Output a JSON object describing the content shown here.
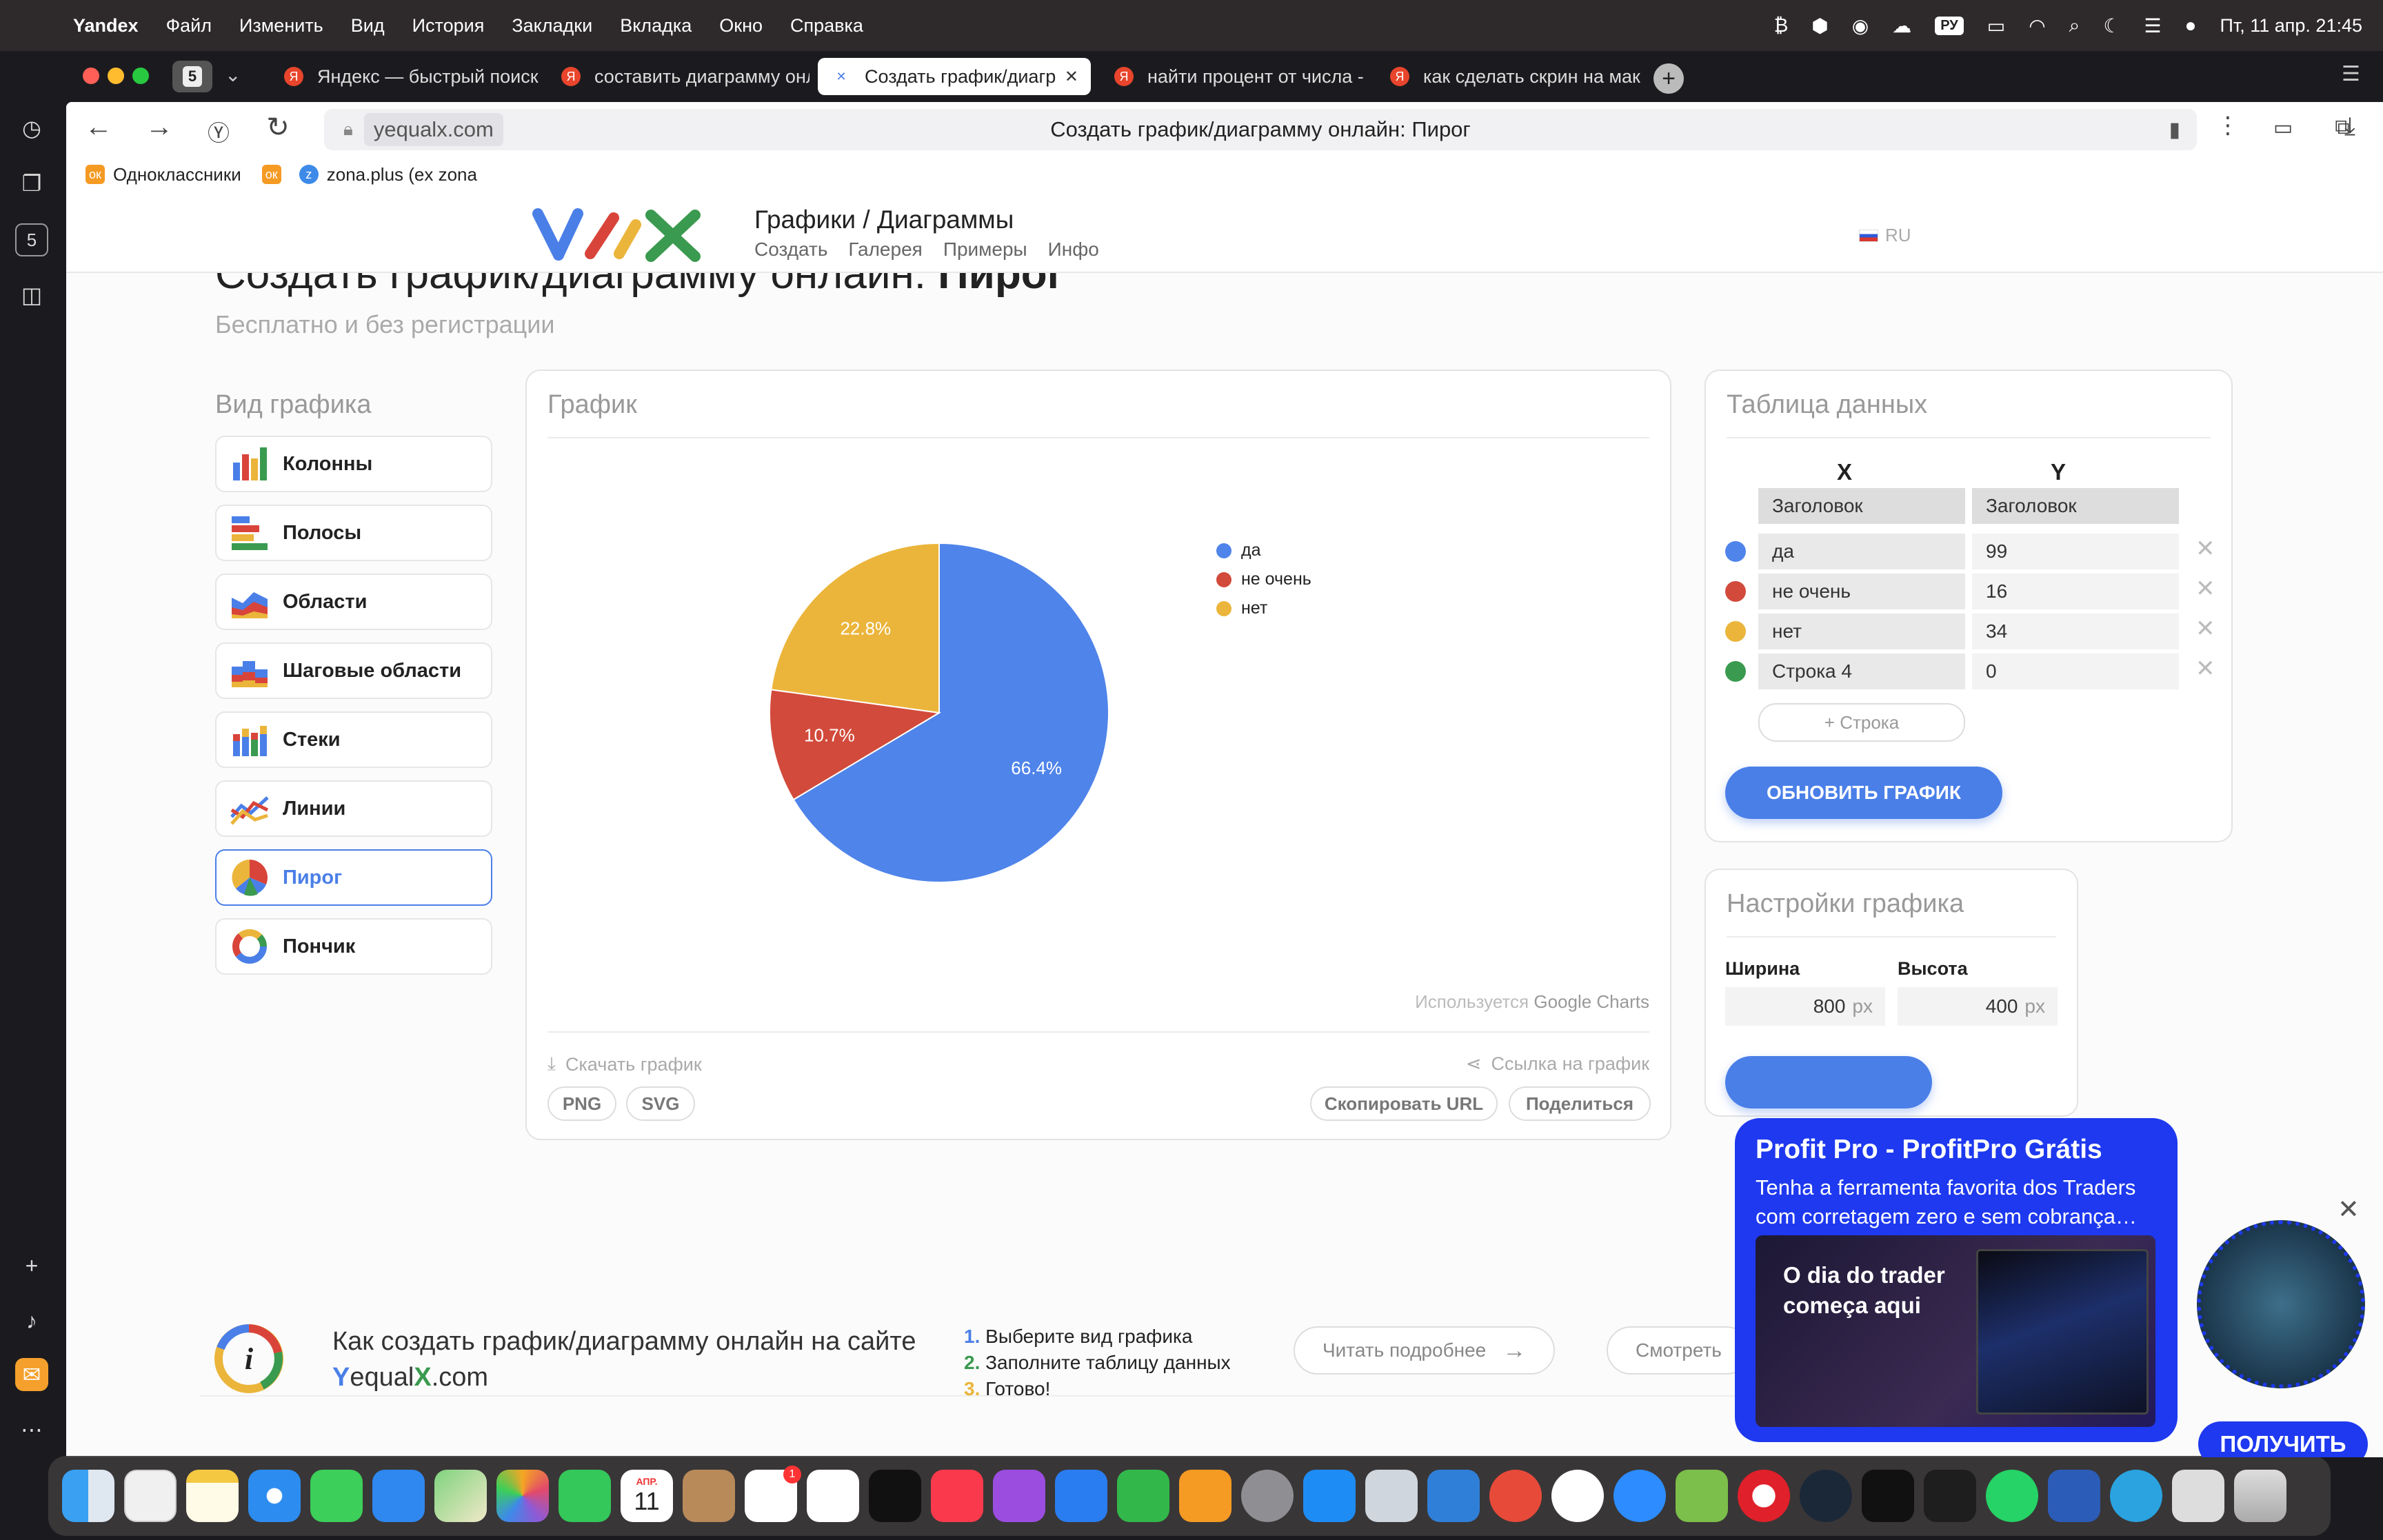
{
  "menubar": {
    "app_name": "Yandex",
    "items": [
      "Файл",
      "Изменить",
      "Вид",
      "История",
      "Закладки",
      "Вкладка",
      "Окно",
      "Справка"
    ],
    "input_badge": "РУ",
    "clock": "Пт, 11 апр.  21:45"
  },
  "tabs": {
    "counter": "5",
    "items": [
      {
        "label": "Яндекс — быстрый поиск"
      },
      {
        "label": "составить диаграмму онл"
      },
      {
        "label": "Создать график/диагр"
      },
      {
        "label": "найти процент от числа -"
      },
      {
        "label": "как сделать скрин на мак"
      }
    ]
  },
  "address": {
    "domain": "yequalx.com",
    "page_title": "Создать график/диаграмму онлайн: Пирог"
  },
  "bookmarks": [
    {
      "label": "Одноклассники",
      "ico": "ok"
    },
    {
      "label": "",
      "ico": "ok"
    },
    {
      "label": "zona.plus (ex zona",
      "ico": "z"
    }
  ],
  "site": {
    "title": "Графики / Диаграммы",
    "nav": [
      "Создать",
      "Галерея",
      "Примеры",
      "Инфо"
    ],
    "lang": "RU",
    "heading_light": "Создать график/диаграмму онлайн: ",
    "heading_bold": "Пирог",
    "subheading": "Бесплатно и без регистрации"
  },
  "chart_types": {
    "label": "Вид графика",
    "items": [
      "Колонны",
      "Полосы",
      "Области",
      "Шаговые области",
      "Стеки",
      "Линии",
      "Пирог",
      "Пончик"
    ],
    "active": "Пирог"
  },
  "chart_card": {
    "title": "График",
    "credit_prefix": "Используется ",
    "credit_name": "Google Charts",
    "download_label": "Скачать график",
    "png": "PNG",
    "svg": "SVG",
    "link_label": "Ссылка на график",
    "copy_url": "Скопировать URL",
    "share": "Поделиться"
  },
  "chart_data": {
    "type": "pie",
    "categories": [
      "да",
      "не очень",
      "нет",
      "Строка 4"
    ],
    "values": [
      99,
      16,
      34,
      0
    ],
    "slice_labels": [
      "66.4%",
      "10.7%",
      "22.8%",
      ""
    ],
    "legend": [
      "да",
      "не очень",
      "нет"
    ],
    "legend_position": "right",
    "colors": [
      "#4f84ea",
      "#d24a3b",
      "#ebb53b",
      "#3a9a4f"
    ],
    "title": ""
  },
  "data_table": {
    "title": "Таблица данных",
    "col_x": "X",
    "col_y": "Y",
    "header_x": "Заголовок",
    "header_y": "Заголовок",
    "rows": [
      {
        "x": "да",
        "y": "99",
        "color": "#4f84ea"
      },
      {
        "x": "не очень",
        "y": "16",
        "color": "#d24a3b"
      },
      {
        "x": "нет",
        "y": "34",
        "color": "#ebb53b"
      },
      {
        "x": "Строка 4",
        "y": "0",
        "color": "#3a9a4f"
      }
    ],
    "add_row": "+ Строка",
    "update": "ОБНОВИТЬ ГРАФИК",
    "delete_glyph": "✕"
  },
  "settings": {
    "title": "Настройки графика",
    "width_label": "Ширина",
    "height_label": "Высота",
    "width": "800",
    "height": "400",
    "unit": "px"
  },
  "howto": {
    "line1": "Как создать график/диаграмму онлайн на сайте",
    "brand_y": "Y",
    "brand_equal": "equal",
    "brand_x": "X",
    "brand_tld": ".com",
    "steps": [
      {
        "num": "1.",
        "text": "Выберите вид графика"
      },
      {
        "num": "2.",
        "text": "Заполните таблицу данных"
      },
      {
        "num": "3.",
        "text": "Готово!"
      }
    ],
    "read_more": "Читать подробнее",
    "watch": "Смотреть"
  },
  "ad": {
    "title": "Profit Pro - ProfitPro Grátis",
    "text": "Tenha a ferramenta favorita dos Traders com corretagem zero e sem cobrança…",
    "headline": "O dia do trader começa aqui",
    "cta": "ПОЛУЧИТЬ",
    "close": "✕"
  },
  "dock": {
    "calendar_month": "АПР.",
    "calendar_day": "11",
    "badge": "1"
  },
  "accent": "#4a7fe8"
}
